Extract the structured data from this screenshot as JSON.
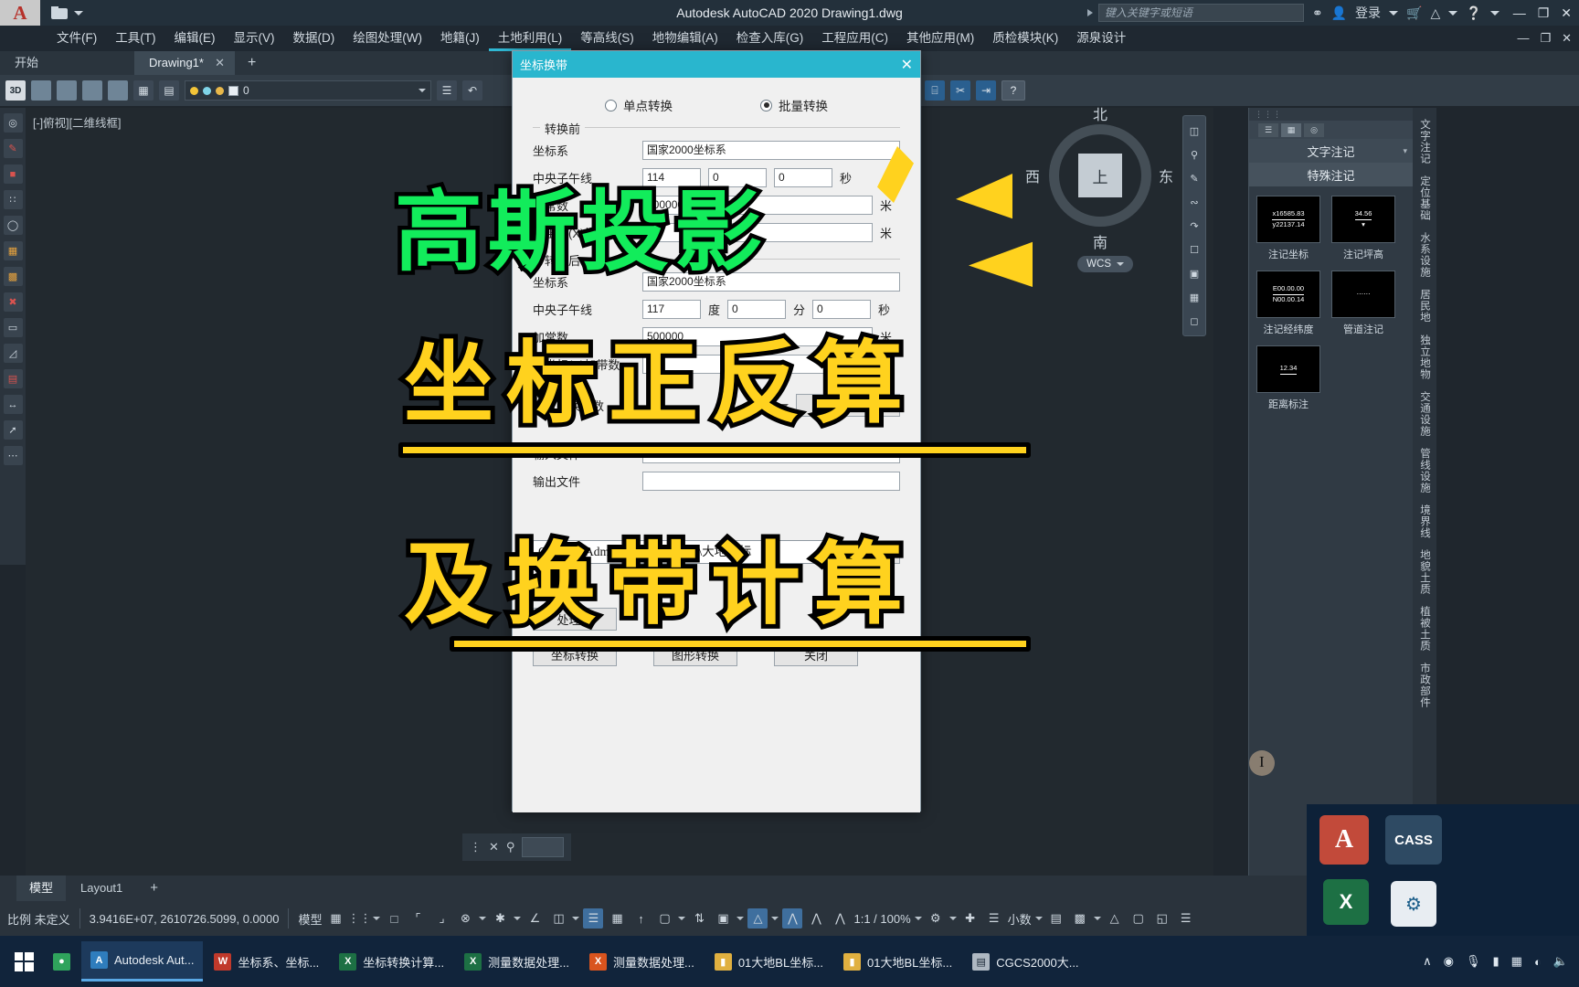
{
  "titlebar": {
    "app_glyph": "A",
    "title": "Autodesk AutoCAD 2020   Drawing1.dwg",
    "search_placeholder": "键入关键字或短语",
    "signin_label": "登录",
    "icons": {
      "binoculars": "⚭",
      "person": "👤",
      "cart": "🛒",
      "cloud": "⌂",
      "help": "?"
    },
    "window_buttons": {
      "minimize": "—",
      "restore": "❐",
      "close": "✕"
    }
  },
  "menubar": {
    "items": [
      {
        "label": "文件(F)"
      },
      {
        "label": "工具(T)"
      },
      {
        "label": "编辑(E)"
      },
      {
        "label": "显示(V)"
      },
      {
        "label": "数据(D)"
      },
      {
        "label": "绘图处理(W)"
      },
      {
        "label": "地籍(J)"
      },
      {
        "label": "土地利用(L)"
      },
      {
        "label": "等高线(S)"
      },
      {
        "label": "地物编辑(A)"
      },
      {
        "label": "检查入库(G)"
      },
      {
        "label": "工程应用(C)"
      },
      {
        "label": "其他应用(M)"
      },
      {
        "label": "质检模块(K)"
      },
      {
        "label": "源泉设计"
      }
    ],
    "highlighted_index": 7,
    "window_buttons": {
      "minimize": "—",
      "restore": "❐",
      "close": "✕"
    }
  },
  "doctabs": {
    "start_label": "开始",
    "tabs": [
      {
        "label": "Drawing1*",
        "close": "✕",
        "active": true
      }
    ],
    "add_label": "+"
  },
  "toolstrip": {
    "buttons": [
      "3D",
      "▦",
      "▣",
      "▩",
      "◨",
      "✎",
      "◈"
    ],
    "layer_value": "0",
    "right_buttons": [
      "✥",
      "⌸",
      "✂",
      "⇥"
    ],
    "help_label": "?"
  },
  "canvas": {
    "viewport_label": "[-]俯视][二维线框]",
    "viewcube": {
      "top": "上",
      "north": "北",
      "south": "南",
      "east": "东",
      "west": "西"
    },
    "wcs_label": "WCS"
  },
  "navbar_right": {
    "icons": [
      "◳",
      "⌕",
      "✎",
      "◐",
      "↷",
      "▭",
      "▣",
      "▤",
      "◧"
    ]
  },
  "palette": {
    "tab_text": "文字注记",
    "header_text": "特殊注记",
    "cards": [
      {
        "thumb_line1": "x16585.83",
        "thumb_line2": "y22137.14",
        "caption": "注记坐标"
      },
      {
        "thumb_line1": "34.56",
        "thumb_line2": "",
        "caption": "注记坪高"
      },
      {
        "thumb_line1": "E00.00.00",
        "thumb_line2": "N00.00.14",
        "caption": "注记经纬度"
      },
      {
        "thumb_line1": "",
        "thumb_line2": "",
        "caption": "管道注记"
      },
      {
        "thumb_line1": "12.34",
        "thumb_line2": "",
        "caption": "距离标注"
      }
    ]
  },
  "vertical_tabs": {
    "items": [
      "文字注记",
      "定位基础",
      "水系设施",
      "居民地",
      "独立地物",
      "交通设施",
      "管线设施",
      "境界线",
      "地貌土质",
      "植被土质",
      "市政部件"
    ]
  },
  "dialog": {
    "title": "坐标换带",
    "close": "✕",
    "modes": [
      {
        "label": "单点转换",
        "selected": false
      },
      {
        "label": "批量转换",
        "selected": true
      }
    ],
    "group_before": {
      "legend": "转换前",
      "rows": [
        {
          "label": "坐标系",
          "value": "国家2000坐标系",
          "unit": ""
        },
        {
          "label": "中央子午线",
          "value": "114",
          "value2": "0",
          "value3": "0",
          "unit": "秒"
        },
        {
          "label": "加常数",
          "value": "500000",
          "unit": "米"
        },
        {
          "label": "北坐标(X)加带数",
          "value": "0",
          "unit": "米"
        }
      ]
    },
    "group_after": {
      "legend": "转换后",
      "rows": [
        {
          "label": "坐标系",
          "value": "国家2000坐标系",
          "unit": ""
        },
        {
          "label": "中央子午线",
          "value": "117",
          "value2": "0",
          "value3": "0",
          "unit": "秒"
        },
        {
          "label": "加常数",
          "value": "500000",
          "unit": "米"
        },
        {
          "label": "北坐标(X)加带数",
          "value": "0",
          "unit": "米"
        }
      ],
      "deg_label": "度",
      "min_label": "分",
      "sec_label": "秒"
    },
    "ellipsoid": {
      "label": "椭球转换参数",
      "edit_button": "编辑参数..."
    },
    "file_group": {
      "input_label": "输入文件",
      "output_label": "输出文件"
    },
    "path_value": "C:\\Users\\Administrator\\Desktop\\大地坐标",
    "select_button": "选择",
    "buttons": {
      "process_block": "处理块",
      "coord_convert": "坐标转换",
      "graphic_convert": "图形转换",
      "close": "关闭"
    }
  },
  "overlay": {
    "line1": "高斯投影",
    "line2": "坐标正反算",
    "line3": "及换带计算",
    "colors": {
      "green": "#12ec5b",
      "yellow": "#ffd21e",
      "stroke": "#000000"
    }
  },
  "commandline": {
    "x_label": "✕",
    "wrench_label": "⚲"
  },
  "modeltabs": {
    "items": [
      {
        "label": "模型",
        "active": true
      },
      {
        "label": "Layout1",
        "active": false
      }
    ],
    "add_label": "+"
  },
  "statusbar": {
    "scale_label": "比例 未定义",
    "coordinates": "3.9416E+07, 2610726.5099, 0.0000",
    "space_label": "模型",
    "zoom_label": "1:1 / 100%",
    "units_label": "小数",
    "icons": [
      "▦",
      "⋮⋮",
      "◱",
      "⊹",
      "⌐",
      "◔",
      "⋎",
      "∠",
      "◻",
      "▤",
      "▩",
      "◫",
      "⬓",
      "⇅",
      "◰",
      "⟁",
      "⚙",
      "✛",
      "▤"
    ]
  },
  "taskbar": {
    "start_label": "",
    "items": [
      {
        "label": "Autodesk Aut...",
        "badge": "A",
        "badge_color": "#2f7dbd",
        "active": true
      },
      {
        "label": "坐标系、坐标...",
        "badge": "W",
        "badge_color": "#c0392b",
        "active": false
      },
      {
        "label": "坐标转换计算...",
        "badge": "X",
        "badge_color": "#1d7044",
        "active": false
      },
      {
        "label": "测量数据处理...",
        "badge": "X",
        "badge_color": "#1d7044",
        "active": false
      },
      {
        "label": "测量数据处理...",
        "badge": "X",
        "badge_color": "#d9541e",
        "active": false
      },
      {
        "label": "01大地BL坐标...",
        "badge": "▮",
        "badge_color": "#e0b040",
        "active": false
      },
      {
        "label": "01大地BL坐标...",
        "badge": "▮",
        "badge_color": "#e0b040",
        "active": false
      },
      {
        "label": "CGCS2000大...",
        "badge": "▤",
        "badge_color": "#aeb8c2",
        "active": false
      }
    ],
    "tray": [
      "∧",
      "◉",
      "⬍",
      "▬",
      "▭",
      "((",
      "◁"
    ]
  }
}
